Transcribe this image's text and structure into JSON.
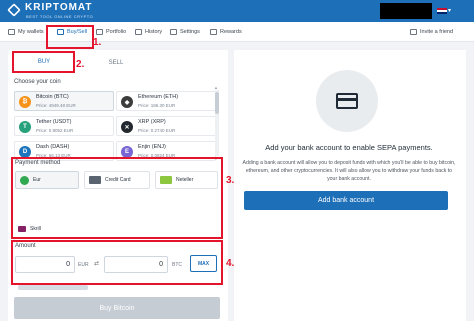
{
  "brand": {
    "name": "KRIPTOMAT",
    "tagline": "BEST TOOL ONLINE CRYPTO"
  },
  "nav": {
    "items": [
      {
        "label": "My wallets",
        "icon": "wallet-icon"
      },
      {
        "label": "Buy/Sell",
        "icon": "card-icon",
        "active": true
      },
      {
        "label": "Portfolio",
        "icon": "chart-icon"
      },
      {
        "label": "History",
        "icon": "history-icon"
      },
      {
        "label": "Settings",
        "icon": "gear-icon"
      },
      {
        "label": "Rewards",
        "icon": "gift-icon"
      }
    ],
    "invite": "Invite a friend"
  },
  "tabs": {
    "buy": "BUY",
    "sell": "SELL"
  },
  "choose_coin": {
    "label": "Choose your coin",
    "coins": [
      {
        "name": "Bitcoin (BTC)",
        "price": "Price: 4949.48 EUR",
        "color": "#f7931a",
        "symbol": "₿"
      },
      {
        "name": "Ethereum (ETH)",
        "price": "Price: 186.30 EUR",
        "color": "#3c3c3d",
        "symbol": "◆"
      },
      {
        "name": "Tether (USDT)",
        "price": "Price: 0.9052 EUR",
        "color": "#26a17b",
        "symbol": "T"
      },
      {
        "name": "XRP (XRP)",
        "price": "Price: 0.2740 EUR",
        "color": "#23292f",
        "symbol": "✕"
      },
      {
        "name": "Dash (DASH)",
        "price": "Price: 66.13 EUR",
        "color": "#1c75bc",
        "symbol": "D"
      },
      {
        "name": "Enjin (ENJ)",
        "price": "Price: 0.0824 EUR",
        "color": "#7866d5",
        "symbol": "E"
      }
    ]
  },
  "payment": {
    "label": "Payment method",
    "methods": [
      {
        "label": "Eur",
        "color": "#2fa84f"
      },
      {
        "label": "Credit Card",
        "color": "#5a6470"
      },
      {
        "label": "Neteller",
        "color": "#8dc63f"
      },
      {
        "label": "Skrill",
        "color": "#862165"
      }
    ]
  },
  "amount": {
    "label": "Amount",
    "fiat_value": "0",
    "fiat_currency": "EUR",
    "coin_value": "0",
    "coin_currency": "BTC",
    "max": "MAX"
  },
  "buy_button": "Buy Bitcoin",
  "bank": {
    "title": "Add your bank account to enable SEPA payments.",
    "description": "Adding a bank account will allow you to deposit funds with which you'll be able to buy bitcoin, ethereum, and other cryptocurrencies. It will also allow you to withdraw your funds back to your bank account.",
    "button": "Add bank account"
  },
  "annotations": {
    "step1": "1.",
    "step2": "2.",
    "step3": "3.",
    "step4": "4."
  },
  "colors": {
    "primary": "#1d6fb8",
    "highlight": "#e3142c"
  }
}
